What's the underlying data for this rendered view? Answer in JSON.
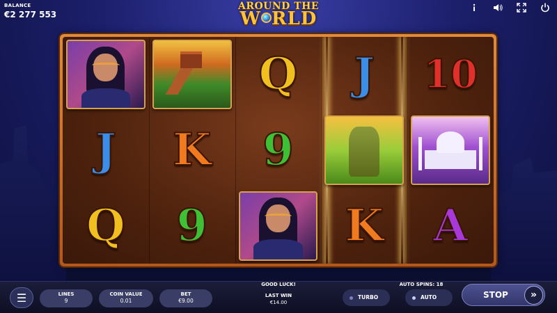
{
  "balance": {
    "label": "BALANCE",
    "value": "€2 277 553"
  },
  "logo": {
    "line1": "Around the",
    "line2_pre": "W",
    "line2_post": "RLD"
  },
  "top_icons": [
    "info-icon",
    "sound-icon",
    "fullscreen-icon",
    "power-icon"
  ],
  "reels": [
    [
      "woman",
      "J",
      "Q"
    ],
    [
      "great-wall",
      "K",
      "9"
    ],
    [
      "Q",
      "9",
      "woman"
    ],
    [
      "J",
      "moai",
      "K"
    ],
    [
      "10",
      "taj-mahal",
      "A"
    ]
  ],
  "bottom": {
    "lines_label": "LINES",
    "lines_value": "9",
    "coin_label": "COIN VALUE",
    "coin_value": "0.01",
    "bet_label": "BET",
    "bet_value": "€9.00",
    "message": "GOOD LUCK!",
    "last_win_label": "LAST WIN",
    "last_win_value": "€14.00",
    "auto_spins_label": "AUTO SPINS: 18",
    "turbo_label": "TURBO",
    "auto_label": "AUTO",
    "stop_label": "STOP",
    "spin_icon": "»"
  },
  "colors": {
    "frame": "#e08a3a",
    "J": "#3a8ee8",
    "Q": "#f0c020",
    "K": "#f07a20",
    "9": "#3fbf35",
    "10": "#e0302c",
    "A": "#a838d8"
  }
}
